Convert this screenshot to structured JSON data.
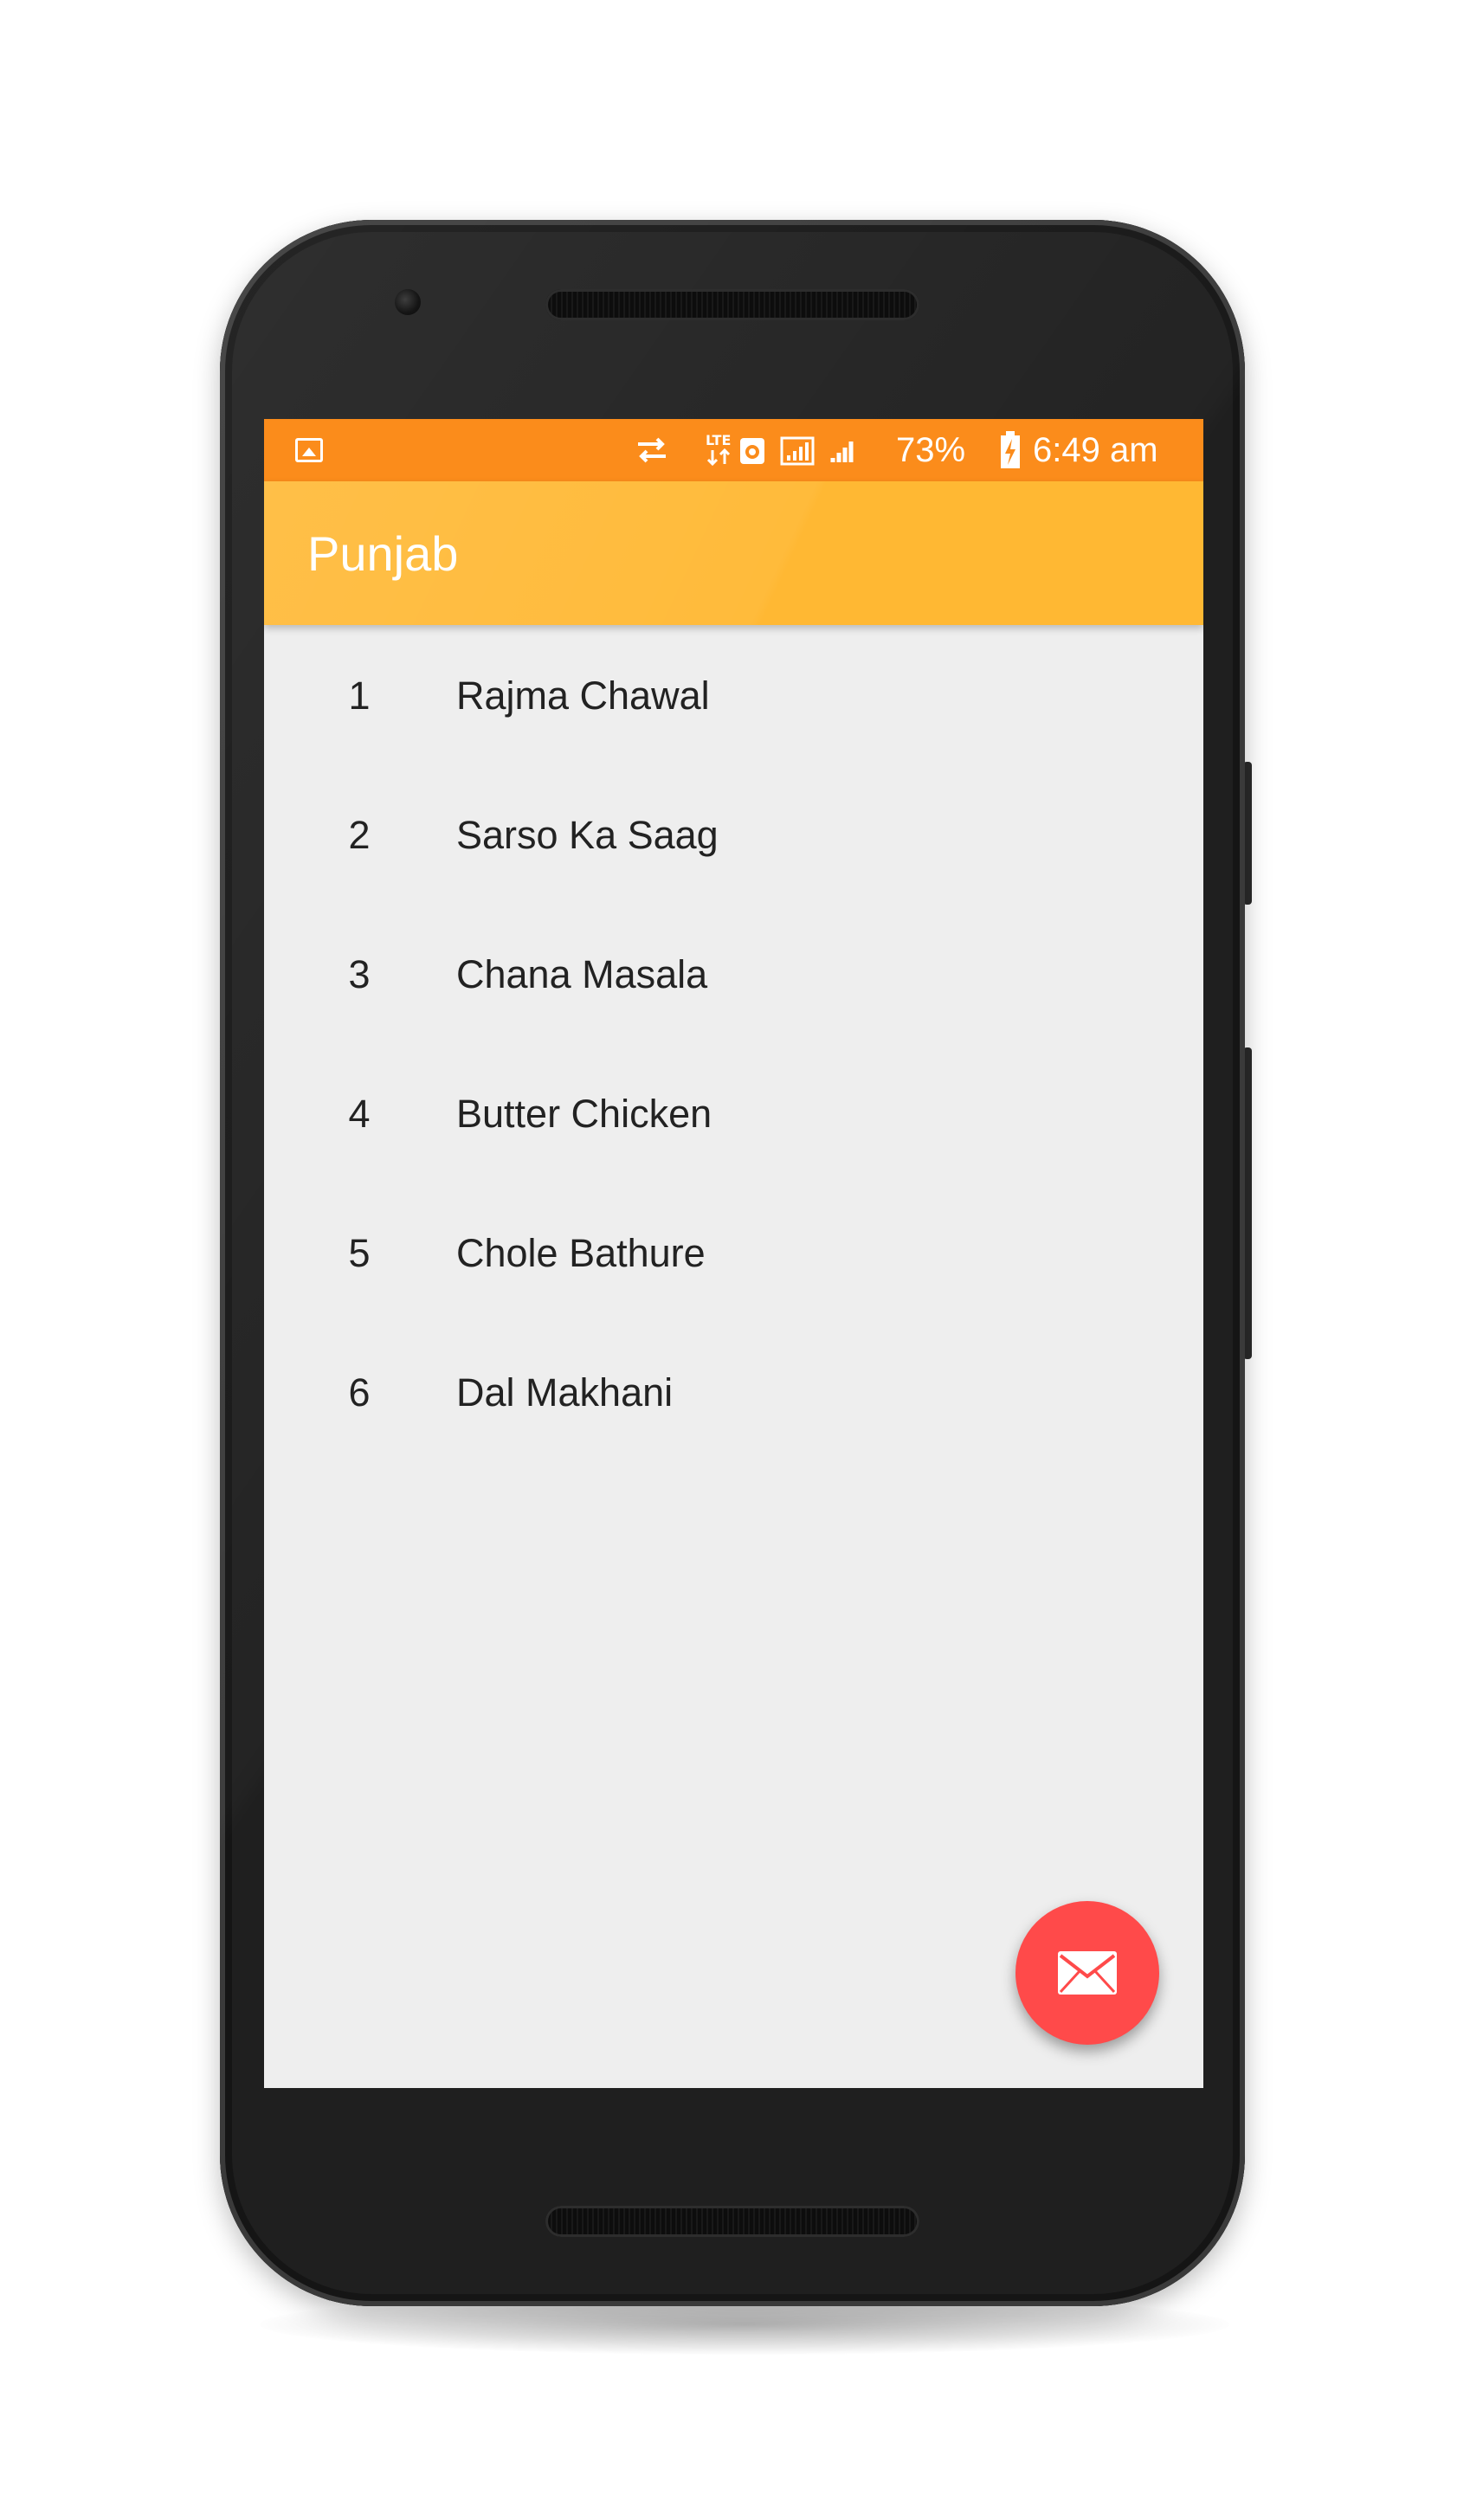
{
  "status_bar": {
    "battery": "73%",
    "time": "6:49 am",
    "icons": [
      "image-notification-icon",
      "data-transfer-icon",
      "lte-icon",
      "vpn-icon",
      "signal-sim1-icon",
      "signal-sim2-icon",
      "battery-charging-icon"
    ]
  },
  "app_bar": {
    "title": "Punjab"
  },
  "list": {
    "items": [
      {
        "number": "1",
        "name": "Rajma Chawal"
      },
      {
        "number": "2",
        "name": "Sarso Ka Saag"
      },
      {
        "number": "3",
        "name": "Chana Masala"
      },
      {
        "number": "4",
        "name": "Butter Chicken"
      },
      {
        "number": "5",
        "name": "Chole Bathure"
      },
      {
        "number": "6",
        "name": "Dal Makhani"
      }
    ]
  },
  "fab": {
    "icon": "mail-icon"
  },
  "colors": {
    "status_bar": "#fb8c1b",
    "app_bar": "#ffb833",
    "background": "#eeeeee",
    "fab": "#ff4a4a"
  }
}
